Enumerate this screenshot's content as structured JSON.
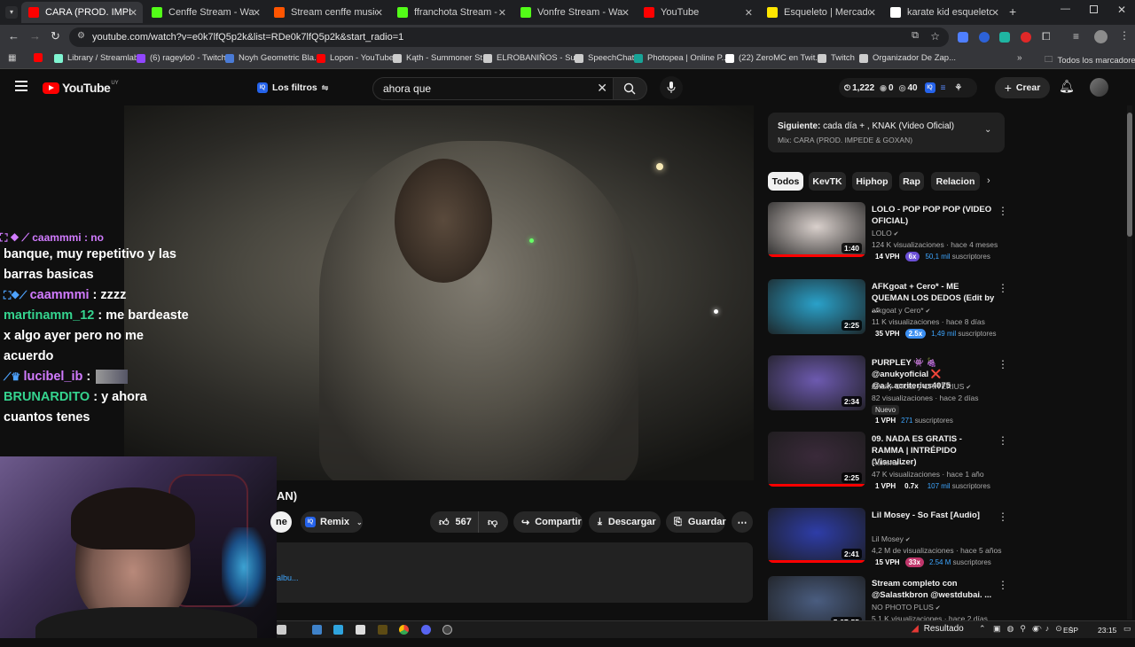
{
  "browser": {
    "tabs": [
      {
        "title": "CARA (PROD. IMPEDE",
        "color": "#ff0000",
        "active": true
      },
      {
        "title": "Cenffe Stream - Watch Li",
        "color": "#53fc18"
      },
      {
        "title": "Stream cenffe music | List",
        "color": "#ff5500"
      },
      {
        "title": "ffranchota Stream - W",
        "color": "#53fc18"
      },
      {
        "title": "Vonfre Stream - Watc",
        "color": "#53fc18"
      },
      {
        "title": "YouTube",
        "color": "#ff0000"
      },
      {
        "title": "Esqueleto | MercadoLibre",
        "color": "#ffe600"
      },
      {
        "title": "karate kid esqueleto - Bus",
        "color": "#ffffff"
      }
    ],
    "url": "youtube.com/watch?v=e0k7lfQ5p2k&list=RDe0k7lfQ5p2k&start_radio=1",
    "bookmarks": [
      {
        "label": "",
        "color": "#ff0000"
      },
      {
        "label": "Library / Streamlabs",
        "color": "#80f5d2"
      },
      {
        "label": "(6) rageylo0 - Twitch",
        "color": "#9146ff"
      },
      {
        "label": "Noyh Geometric Bla...",
        "color": "#4a7bd6"
      },
      {
        "label": "Lopon - YouTube",
        "color": "#ff0000"
      },
      {
        "label": "Kąth - Summoner St...",
        "color": "#cccccc"
      },
      {
        "label": "ELROBANIÑOS - Su...",
        "color": "#cccccc"
      },
      {
        "label": "SpeechChat",
        "color": "#cccccc"
      },
      {
        "label": "Photopea | Online P...",
        "color": "#18a497"
      },
      {
        "label": "(22) ZeroMC en Twit...",
        "color": "#ffffff"
      },
      {
        "label": "Twitch",
        "color": "#cccccc"
      },
      {
        "label": "Organizador De Zap...",
        "color": "#cccccc"
      }
    ],
    "all_bookmarks": "Todos los marcadores"
  },
  "youtube": {
    "logo": "YouTube",
    "region": "UY",
    "filters": "Los filtros",
    "search": "ahora que",
    "stats": {
      "a": "1,222",
      "b": "0",
      "c": "40"
    },
    "create": "Crear"
  },
  "chat": [
    {
      "user": "",
      "text": "banque, muy repetitivo y las barras basicas",
      "ucolor": "#ffffff"
    },
    {
      "user": "caammmi",
      "text": ": zzzz",
      "ucolor": "#d17bff"
    },
    {
      "user": "martinamm_12",
      "text": ": me bardeaste x algo ayer pero no me acuerdo",
      "ucolor": "#35d48f"
    },
    {
      "user": "lucibel_ib",
      "text": ":",
      "ucolor": "#d17bff"
    },
    {
      "user": "BRUNARDITO",
      "text": ": y ahora cuantos tenes",
      "ucolor": "#35d48f"
    }
  ],
  "player": {
    "title_fragment": "AN)",
    "remix": "Remix",
    "likes": "567",
    "share": "Compartir",
    "download": "Descargar",
    "save": "Guardar",
    "desc_fragment": "albu..."
  },
  "sidebar": {
    "next_label": "Siguiente:",
    "next_title": "cada día + , KNAK (Video Oficial)",
    "mix": "Mix: CARA (PROD. IMPEDE & GOXAN)",
    "chips": [
      "Todos",
      "KevTK",
      "Hiphop",
      "Rap",
      "Relacion"
    ],
    "videos": [
      {
        "title": "LOLO - POP POP POP (VIDEO OFICIAL)",
        "channel": "LOLO",
        "stats": "124 K visualizaciones · hace 4 meses",
        "vph": "14 VPH",
        "mult": "6x",
        "mult_color": "#6b4fd6",
        "subs": "50,1 mil",
        "subs_label": "suscriptores",
        "duration": "1:40",
        "progress": 0.99,
        "thumb": "#d9d0cc",
        "badge": ""
      },
      {
        "title": "AFKgoat + Cero* - ME QUEMAN LOS DEDOS (Edit by ...",
        "channel": "afkgoat y Cero*",
        "stats": "11 K visualizaciones · hace 8 días",
        "vph": "35 VPH",
        "mult": "2.5x",
        "mult_color": "#3b8ef0",
        "subs": "1,49 mil",
        "subs_label": "suscriptores",
        "duration": "2:25",
        "progress": 0,
        "thumb": "#2aa1c9",
        "badge": ""
      },
      {
        "title": "PURPLEY 👾 🍇 @anukyoficial ❌ @a.k.acriterius4075",
        "channel": "Anuky Oficial y CRITERIUS",
        "stats": "82 visualizaciones · hace 2 días",
        "vph": "1 VPH",
        "mult": "",
        "mult_color": "",
        "subs": "271",
        "subs_label": "suscriptores",
        "duration": "2:34",
        "progress": 0,
        "thumb": "#6d5ab0",
        "badge": "Nuevo"
      },
      {
        "title": "09. NADA ES GRATIS - RAMMA | INTRÉPIDO (Visualizer)",
        "channel": "Ramma",
        "stats": "47 K visualizaciones · hace 1 año",
        "vph": "1 VPH",
        "mult": "0.7x",
        "mult_color": "",
        "subs": "107 mil",
        "subs_label": "suscriptores",
        "duration": "2:25",
        "progress": 0.99,
        "thumb": "#3a2a3a",
        "badge": ""
      },
      {
        "title": "Lil Mosey - So Fast [Audio]",
        "channel": "Lil Mosey",
        "stats": "4,2 M de visualizaciones · hace 5 años",
        "vph": "15 VPH",
        "mult": "33x",
        "mult_color": "#c0366b",
        "subs": "2.54 M",
        "subs_label": "suscriptores",
        "duration": "2:41",
        "progress": 0.99,
        "thumb": "#2e3da8",
        "badge": ""
      },
      {
        "title": "Stream completo con @Salastkbron @westdubai. ...",
        "channel": "NO PHOTO PLUS",
        "stats": "5,1 K visualizaciones · hace 2 días",
        "vph": "",
        "mult": "",
        "mult_color": "",
        "subs": "",
        "subs_label": "",
        "duration": "5:27:55",
        "progress": 0,
        "thumb": "#4a5d80",
        "badge": ""
      }
    ]
  },
  "taskbar": {
    "resultado": "Resultado",
    "lang": "ESP",
    "time": "23:15"
  }
}
